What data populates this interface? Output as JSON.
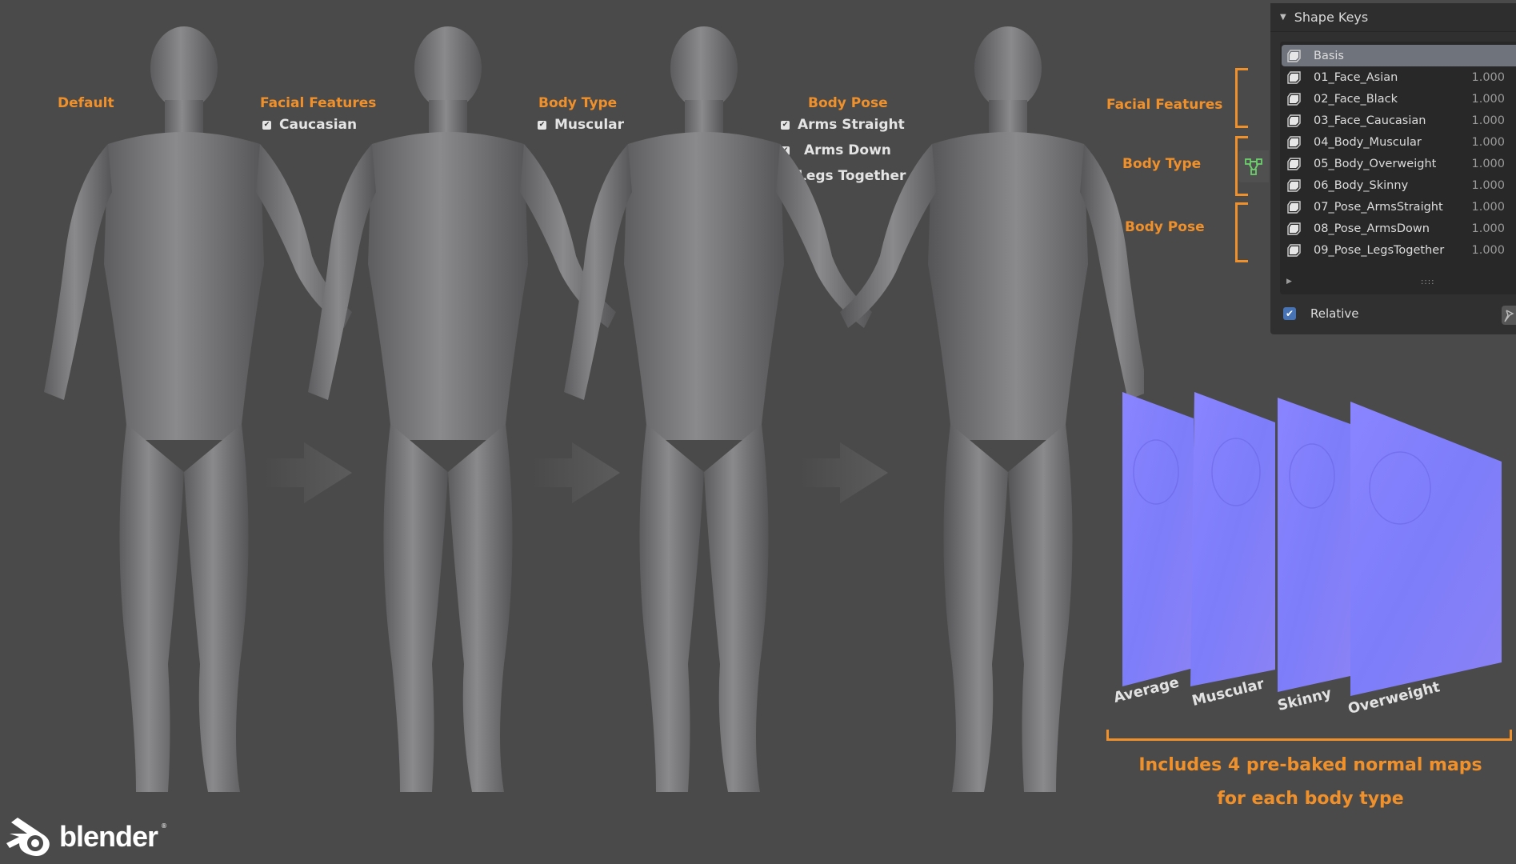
{
  "stages": [
    {
      "heading": "Default",
      "options": []
    },
    {
      "heading": "Facial Features",
      "options": [
        {
          "label": "Caucasian",
          "checked": true
        }
      ]
    },
    {
      "heading": "Body Type",
      "options": [
        {
          "label": "Muscular",
          "checked": true
        }
      ]
    },
    {
      "heading": "Body Pose",
      "options": [
        {
          "label": "Arms Straight",
          "checked": true
        },
        {
          "label": "Arms Down",
          "checked": true
        },
        {
          "label": "Legs Together",
          "checked": true
        }
      ]
    }
  ],
  "side_labels": {
    "facial_features": "Facial Features",
    "body_type": "Body Type",
    "body_pose": "Body Pose"
  },
  "shape_keys_panel": {
    "title": "Shape Keys",
    "keys": [
      {
        "name": "Basis",
        "value": "",
        "active": true
      },
      {
        "name": "01_Face_Asian",
        "value": "1.000"
      },
      {
        "name": "02_Face_Black",
        "value": "1.000"
      },
      {
        "name": "03_Face_Caucasian",
        "value": "1.000"
      },
      {
        "name": "04_Body_Muscular",
        "value": "1.000"
      },
      {
        "name": "05_Body_Overweight",
        "value": "1.000"
      },
      {
        "name": "06_Body_Skinny",
        "value": "1.000"
      },
      {
        "name": "07_Pose_ArmsStraight",
        "value": "1.000"
      },
      {
        "name": "08_Pose_ArmsDown",
        "value": "1.000"
      },
      {
        "name": "09_Pose_LegsTogether",
        "value": "1.000"
      }
    ],
    "grip": "::::",
    "relative_label": "Relative",
    "relative_checked": true
  },
  "normal_maps": {
    "labels": [
      "Average",
      "Muscular",
      "Skinny",
      "Overweight"
    ],
    "caption_line1": "Includes 4 pre-baked normal maps",
    "caption_line2": "for each body type"
  },
  "logo": {
    "text": "blender",
    "registered": "®"
  },
  "colors": {
    "background": "#4a4a4a",
    "accent_orange": "#f0902a",
    "panel_bg": "#303030",
    "active_row": "#6f737b",
    "checkbox_blue": "#4772b3",
    "normal_map": "#8080ff",
    "mesh_green": "#6ccf6c"
  },
  "icons": {
    "shape_key": "shape-key-icon",
    "vertex_data_tab": "mesh-vertices-icon",
    "pin": "pin-icon",
    "expand": "triangle-right-icon",
    "collapse": "triangle-down-icon"
  }
}
